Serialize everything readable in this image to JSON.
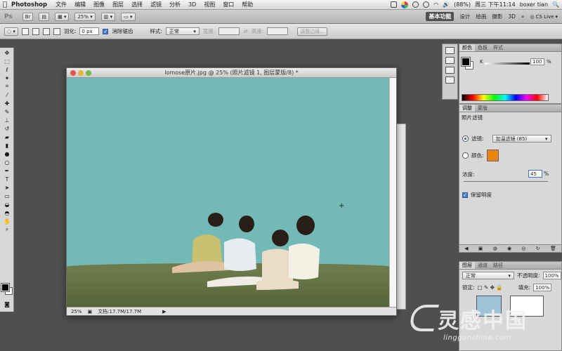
{
  "menubar": {
    "apple": "",
    "app": "Photoshop",
    "items": [
      "文件",
      "编辑",
      "图像",
      "图层",
      "选择",
      "滤镜",
      "分析",
      "3D",
      "视图",
      "窗口",
      "帮助"
    ],
    "battery": "(88%)",
    "clock": "周三 下午11:14",
    "user": "boxer tian"
  },
  "appbar": {
    "ps": "Ps",
    "zoom": "25%",
    "workspaces": [
      "基本功能",
      "设计",
      "绘画",
      "摄影",
      "3D"
    ],
    "more": "»",
    "cslive": "CS Live"
  },
  "options": {
    "feather_label": "羽化:",
    "feather_value": "0 px",
    "antialias_label": "消除锯齿",
    "style_label": "样式:",
    "style_value": "正常",
    "width_label": "宽度:",
    "height_label": "高度:",
    "refine_label": "调整边缘..."
  },
  "document": {
    "title": "lomose原片.jpg @ 25% (照片滤镜 1, 图层蒙版/8) *",
    "zoom": "25%",
    "doc_info": "文档:17.7M/17.7M"
  },
  "color_panel": {
    "tabs": [
      "颜色",
      "色板",
      "样式"
    ],
    "k_label": "K",
    "k_value": "100",
    "pct": "%"
  },
  "adjust_panel": {
    "tabs": [
      "调整",
      "蒙版"
    ],
    "title": "照片滤镜",
    "filter_label": "滤镜:",
    "filter_value": "加温滤镜 (85)",
    "color_label": "颜色:",
    "density_label": "浓度:",
    "density_value": "45",
    "pct": "%",
    "preserve_label": "保留明度"
  },
  "layers_panel": {
    "tabs": [
      "图层",
      "通道",
      "路径"
    ],
    "blend": "正常",
    "opacity_label": "不透明度:",
    "opacity_value": "100%",
    "lock_label": "锁定:",
    "fill_label": "填充:",
    "fill_value": "100%"
  },
  "watermark": {
    "big": "灵感中国",
    "small": "lingganchina.com"
  },
  "colors": {
    "sky": "#73b9b5",
    "filter_color": "#e9860f",
    "workspace_bg": "#4f4f4f"
  }
}
